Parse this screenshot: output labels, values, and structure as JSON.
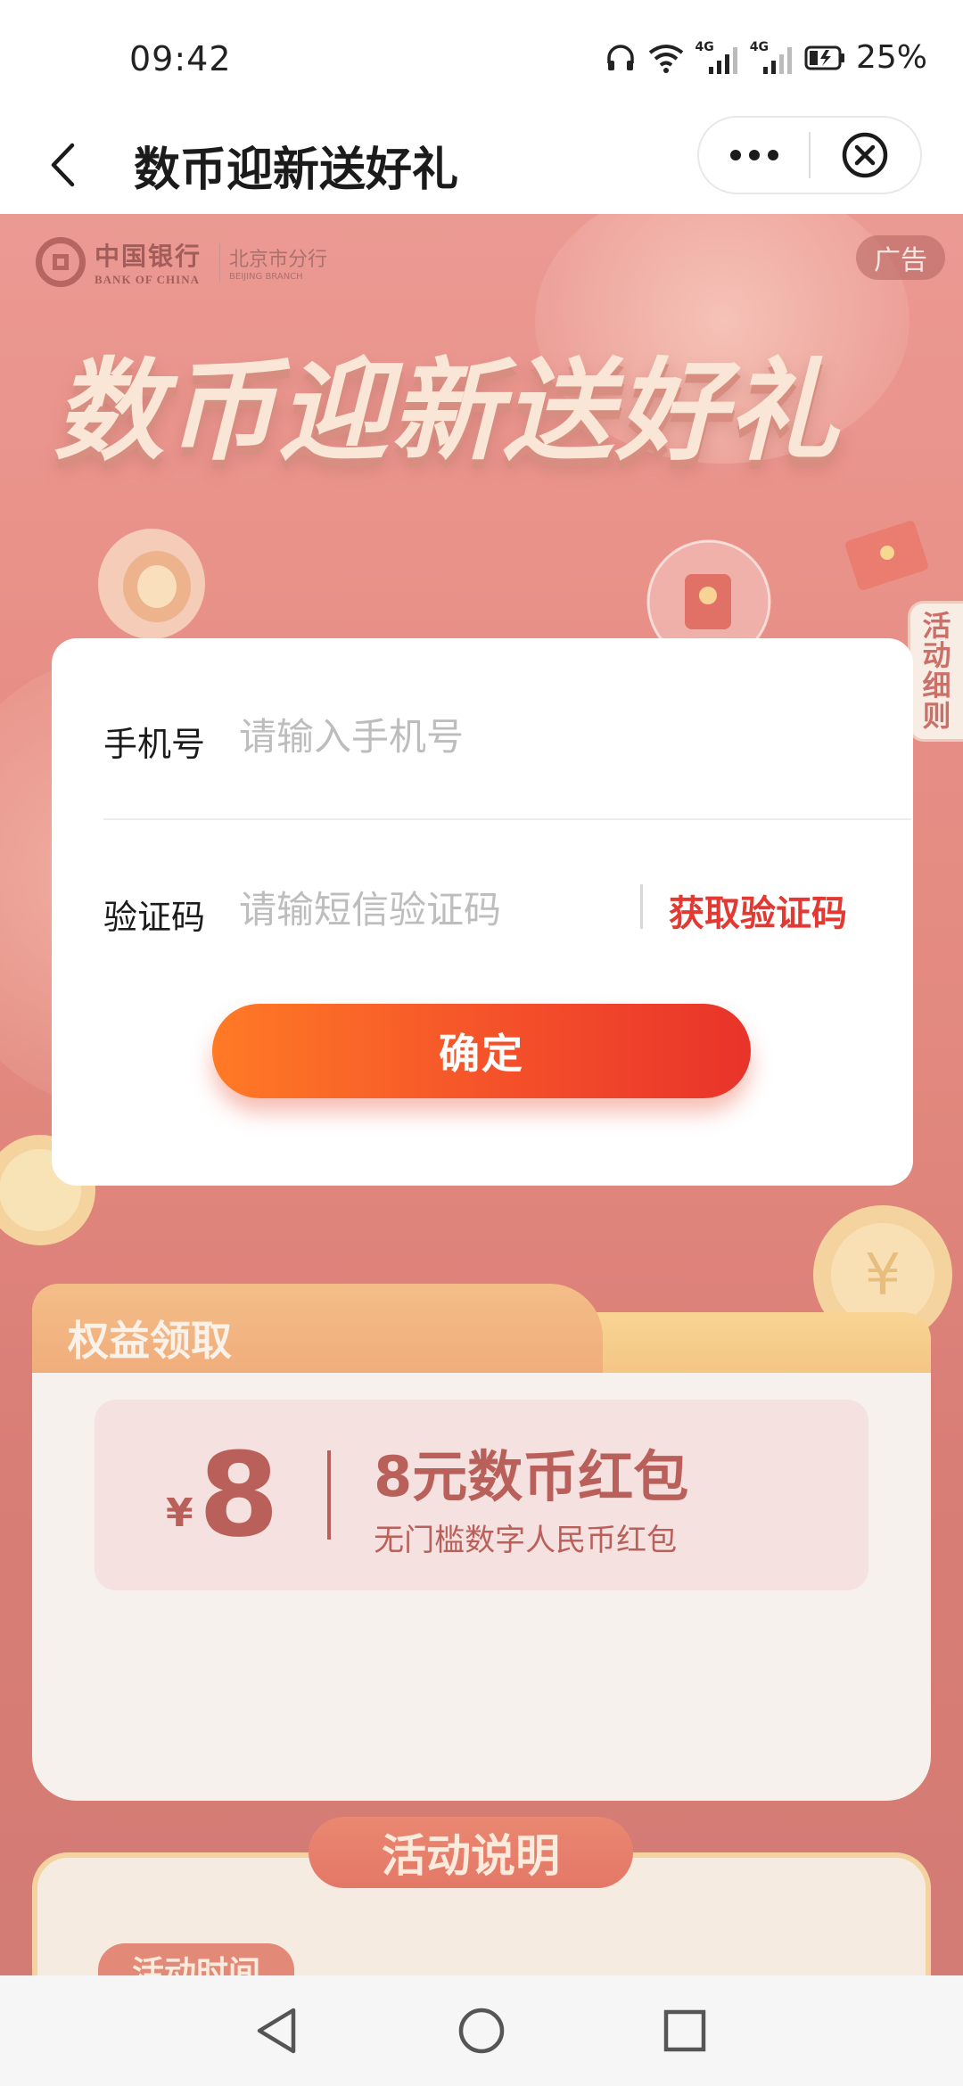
{
  "status_bar": {
    "time": "09:42",
    "network_1": "4G",
    "network_2": "4G",
    "battery": "25%"
  },
  "nav": {
    "title": "数币迎新送好礼",
    "icons": [
      "back-arrow-icon",
      "more-dots-icon",
      "close-circle-icon"
    ]
  },
  "banner": {
    "bank_name_cn": "中国银行",
    "bank_name_en": "BANK OF CHINA",
    "branch_cn": "北京市分行",
    "branch_en": "BEIJING BRANCH",
    "ad_label": "广告",
    "headline": "数币迎新送好礼",
    "rules_tab": "活动细则"
  },
  "dialog": {
    "phone_label": "手机号",
    "phone_placeholder": "请输入手机号",
    "code_label": "验证码",
    "code_placeholder": "请输短信验证码",
    "get_code_label": "获取验证码",
    "confirm_label": "确定"
  },
  "rights": {
    "title": "权益领取",
    "coupon": {
      "currency": "¥",
      "amount": "8",
      "name": "8元数币红包",
      "description": "无门槛数字人民币红包"
    }
  },
  "activity": {
    "header": "活动说明",
    "time_label": "活动时间"
  },
  "system_nav": [
    "back-triangle-icon",
    "home-circle-icon",
    "recents-square-icon"
  ],
  "colors": {
    "accent_red": "#e23a33",
    "button_gradient_start": "#ff7a25",
    "button_gradient_end": "#e8332a",
    "banner_bg": "#e0685c",
    "coupon_text": "#9e231b"
  }
}
